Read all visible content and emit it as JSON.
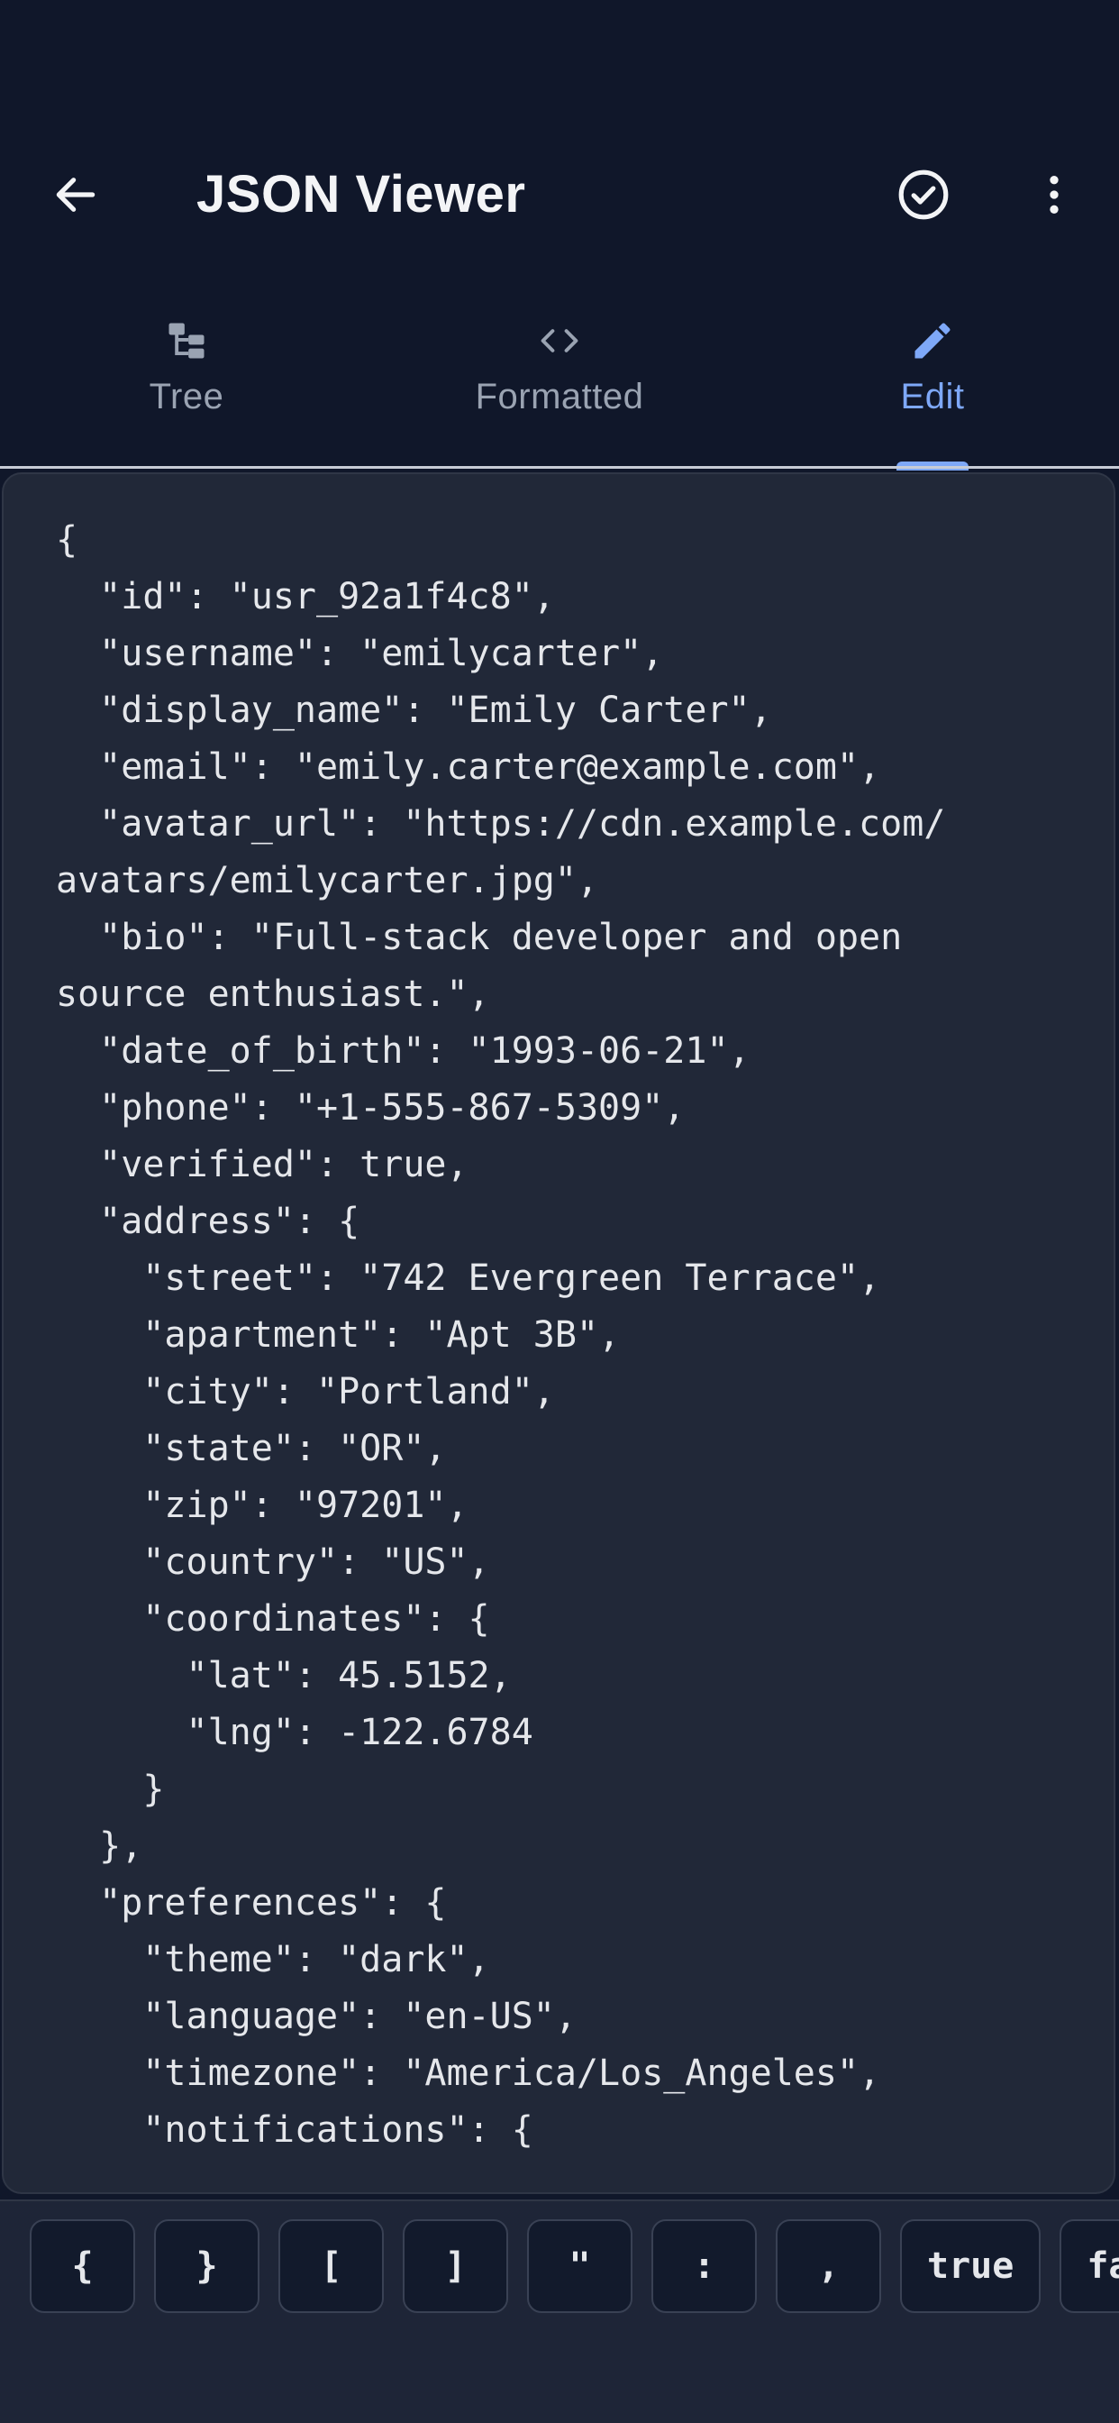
{
  "app": {
    "title": "JSON Viewer",
    "icons": {
      "back": "arrow-left-icon",
      "check": "check-circle-icon",
      "more": "more-vertical-icon"
    }
  },
  "tabs": [
    {
      "label": "Tree",
      "icon": "tree-icon",
      "active": false
    },
    {
      "label": "Formatted",
      "icon": "code-icon",
      "active": false
    },
    {
      "label": "Edit",
      "icon": "pencil-icon",
      "active": true
    }
  ],
  "editor": {
    "lines": [
      "{",
      "  \"id\": \"usr_92a1f4c8\",",
      "  \"username\": \"emilycarter\",",
      "  \"display_name\": \"Emily Carter\",",
      "  \"email\": \"emily.carter@example.com\",",
      "  \"avatar_url\": \"https://cdn.example.com/",
      "avatars/emilycarter.jpg\",",
      "  \"bio\": \"Full-stack developer and open",
      "source enthusiast.\",",
      "  \"date_of_birth\": \"1993-06-21\",",
      "  \"phone\": \"+1-555-867-5309\",",
      "  \"verified\": true,",
      "  \"address\": {",
      "    \"street\": \"742 Evergreen Terrace\",",
      "    \"apartment\": \"Apt 3B\",",
      "    \"city\": \"Portland\",",
      "    \"state\": \"OR\",",
      "    \"zip\": \"97201\",",
      "    \"country\": \"US\",",
      "    \"coordinates\": {",
      "      \"lat\": 45.5152,",
      "      \"lng\": -122.6784",
      "    }",
      "  },",
      "  \"preferences\": {",
      "    \"theme\": \"dark\",",
      "    \"language\": \"en-US\",",
      "    \"timezone\": \"America/Los_Angeles\",",
      "    \"notifications\": {"
    ]
  },
  "keybar": {
    "keys": [
      "{",
      "}",
      "[",
      "]",
      "\"",
      ":",
      ",",
      "true",
      "false"
    ]
  },
  "colors": {
    "background": "#10172a",
    "editor": "#212838",
    "accent": "#7ea8f8",
    "text": "#e5e7eb",
    "muted": "#9aa3b2"
  }
}
